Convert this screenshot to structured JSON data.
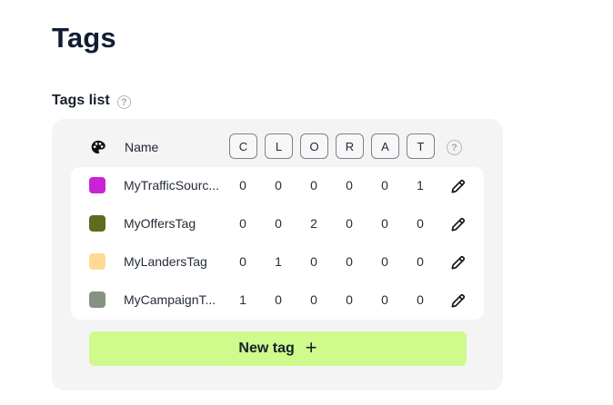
{
  "page": {
    "title": "Tags"
  },
  "tags_section": {
    "title": "Tags list",
    "help_symbol": "?"
  },
  "table": {
    "name_header": "Name",
    "columns": [
      "C",
      "L",
      "O",
      "R",
      "A",
      "T"
    ],
    "help_symbol": "?",
    "rows": [
      {
        "name": "MyTrafficSourceTag",
        "display_name": "MyTrafficSourc...",
        "color": "#c923d6",
        "counts": [
          "0",
          "0",
          "0",
          "0",
          "0",
          "1"
        ]
      },
      {
        "name": "MyOffersTag",
        "display_name": "MyOffersTag",
        "color": "#5d6c1f",
        "counts": [
          "0",
          "0",
          "2",
          "0",
          "0",
          "0"
        ]
      },
      {
        "name": "MyLandersTag",
        "display_name": "MyLandersTag",
        "color": "#ffd996",
        "counts": [
          "0",
          "1",
          "0",
          "0",
          "0",
          "0"
        ]
      },
      {
        "name": "MyCampaignTag",
        "display_name": "MyCampaignT...",
        "color": "#849380",
        "counts": [
          "1",
          "0",
          "0",
          "0",
          "0",
          "0"
        ]
      }
    ]
  },
  "new_tag_button": {
    "label": "New tag",
    "icon": "+"
  },
  "icons": {
    "palette": "palette-icon",
    "edit": "pencil-icon",
    "help": "help-circle-icon"
  },
  "colors": {
    "panel_bg": "#f4f4f5",
    "accent_green": "#cffa8c"
  }
}
